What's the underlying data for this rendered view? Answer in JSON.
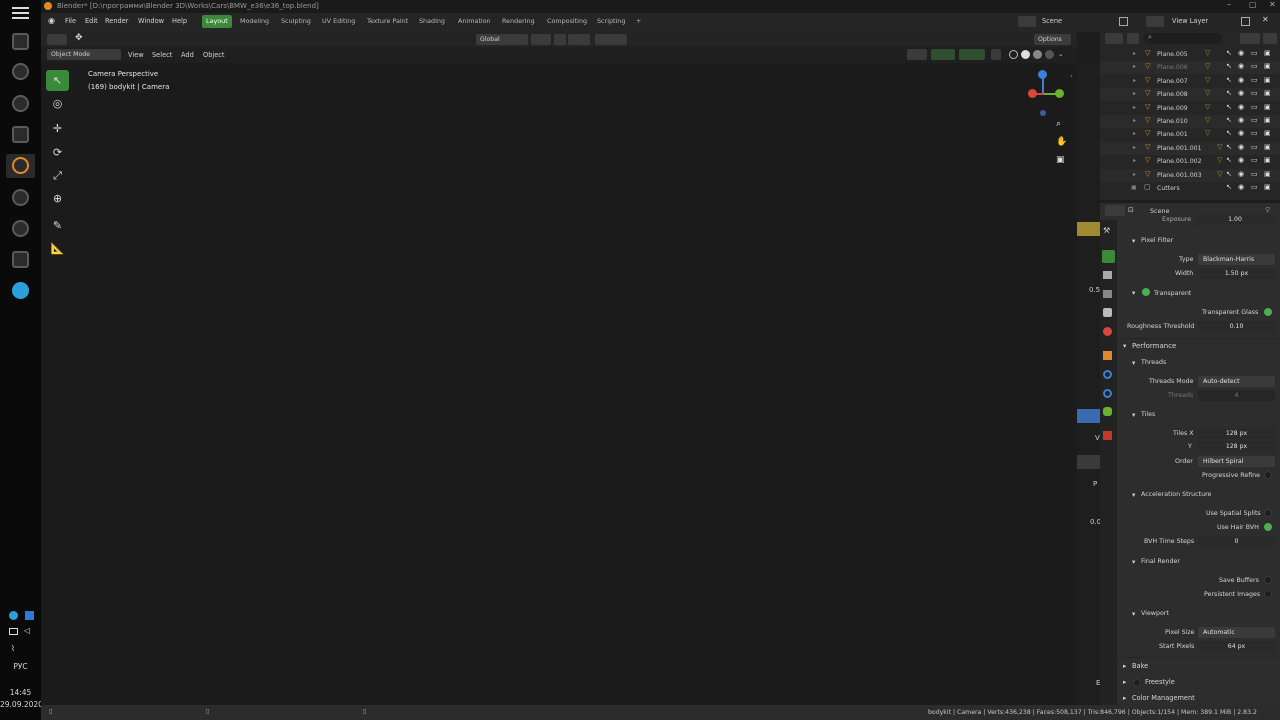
{
  "window_title": "Blender* [D:\\программи\\Blender 3D\\Works\\Cars\\BMW_e36\\e36_top.blend]",
  "menu": [
    "File",
    "Edit",
    "Render",
    "Window",
    "Help"
  ],
  "workspaces": [
    "Layout",
    "Modeling",
    "Sculpting",
    "UV Editing",
    "Texture Paint",
    "Shading",
    "Animation",
    "Rendering",
    "Compositing",
    "Scripting"
  ],
  "workspace_add": "+",
  "scene_label": "Scene",
  "view_layer_label": "View Layer",
  "toolhdr": {
    "orientation": "Global",
    "options": "Options"
  },
  "viewhdr": {
    "mode": "Object Mode",
    "items": [
      "View",
      "Select",
      "Add",
      "Object"
    ]
  },
  "viewport": {
    "title": "Camera Perspective",
    "subtitle": "(169) bodykit | Camera"
  },
  "outliner": {
    "rows": [
      "Plane.005",
      "Plane.006",
      "Plane.007",
      "Plane.008",
      "Plane.009",
      "Plane.010",
      "Plane.001",
      "Plane.001.001",
      "Plane.001.002",
      "Plane.001.003",
      "Cutters"
    ],
    "dim_rows": [
      1
    ]
  },
  "props": {
    "header": "Scene",
    "exposure_label": "Exposure",
    "exposure_value": "1.00",
    "pixel_filter": "Pixel Filter",
    "type_label": "Type",
    "type_value": "Blackman-Harris",
    "width_label": "Width",
    "width_value": "1.50 px",
    "transparent": "Transparent",
    "transparent_glass": "Transparent Glass",
    "roughness_label": "Roughness Threshold",
    "roughness_value": "0.10",
    "performance": "Performance",
    "threads": "Threads",
    "threads_mode_label": "Threads Mode",
    "threads_mode_value": "Auto-detect",
    "threads_label": "Threads",
    "threads_value": "4",
    "tiles": "Tiles",
    "tiles_x_label": "Tiles X",
    "tiles_x_value": "128 px",
    "tiles_y_label": "Y",
    "tiles_y_value": "128 px",
    "order_label": "Order",
    "order_value": "Hilbert Spiral",
    "progressive": "Progressive Refine",
    "accel": "Acceleration Structure",
    "spatial": "Use Spatial Splits",
    "hair": "Use Hair BVH",
    "bvh_label": "BVH Time Steps",
    "bvh_value": "0",
    "final_render": "Final Render",
    "save_buffers": "Save Buffers",
    "persistent": "Persistent Images",
    "viewport": "Viewport",
    "pixel_size_label": "Pixel Size",
    "pixel_size_value": "Automatic",
    "start_pixels_label": "Start Pixels",
    "start_pixels_value": "64 px",
    "bake": "Bake",
    "freestyle": "Freestyle",
    "color_mgmt": "Color Management"
  },
  "strip_labels": {
    "a": "0.5",
    "b": "V",
    "c": "P",
    "d": "0.0",
    "e": "E"
  },
  "taskbar": {
    "lang": "РУС",
    "time": "14:45",
    "date": "29.09.2020"
  },
  "status": "bodykit | Camera | Verts:436,238 | Faces:508,137 | Tris:846,796 | Objects:1/154 | Mem: 389.1 MiB | 2.83.2",
  "colors": {
    "accent_green": "#3a8a3a",
    "outliner_icon_orange": "#e08a2e",
    "gizmo_blue": "#3b7fd9",
    "gizmo_red": "#d9463b",
    "gizmo_green": "#6bb02f"
  }
}
